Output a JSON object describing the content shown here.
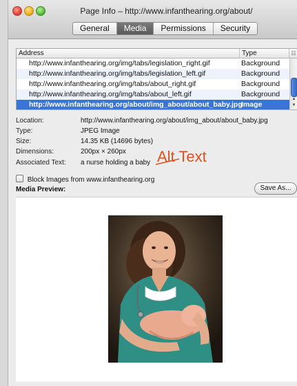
{
  "window": {
    "title": "Page Info – http://www.infanthearing.org/about/"
  },
  "tabs": [
    {
      "label": "General",
      "active": false
    },
    {
      "label": "Media",
      "active": true
    },
    {
      "label": "Permissions",
      "active": false
    },
    {
      "label": "Security",
      "active": false
    }
  ],
  "table": {
    "headers": {
      "address": "Address",
      "type": "Type"
    },
    "rows": [
      {
        "address": "http://www.infanthearing.org/img/tabs/legislation_right.gif",
        "type": "Background"
      },
      {
        "address": "http://www.infanthearing.org/img/tabs/legislation_left.gif",
        "type": "Background"
      },
      {
        "address": "http://www.infanthearing.org/img/tabs/about_right.gif",
        "type": "Background"
      },
      {
        "address": "http://www.infanthearing.org/img/tabs/about_left.gif",
        "type": "Background"
      },
      {
        "address": "http://www.infanthearing.org/about/img_about/about_baby.jpg",
        "type": "Image",
        "selected": true
      }
    ]
  },
  "info": {
    "location_label": "Location:",
    "location_value": "http://www.infanthearing.org/about/img_about/about_baby.jpg",
    "type_label": "Type:",
    "type_value": "JPEG Image",
    "size_label": "Size:",
    "size_value": "14.35 KB (14696 bytes)",
    "dimensions_label": "Dimensions:",
    "dimensions_value": "200px × 260px",
    "assoc_label": "Associated Text:",
    "assoc_value": "a nurse holding a baby"
  },
  "annotation": {
    "text": "Alt Text",
    "color": "#d9541e"
  },
  "block_images_label": "Block Images from www.infanthearing.org",
  "media_preview_label": "Media Preview:",
  "save_as_label": "Save As..."
}
